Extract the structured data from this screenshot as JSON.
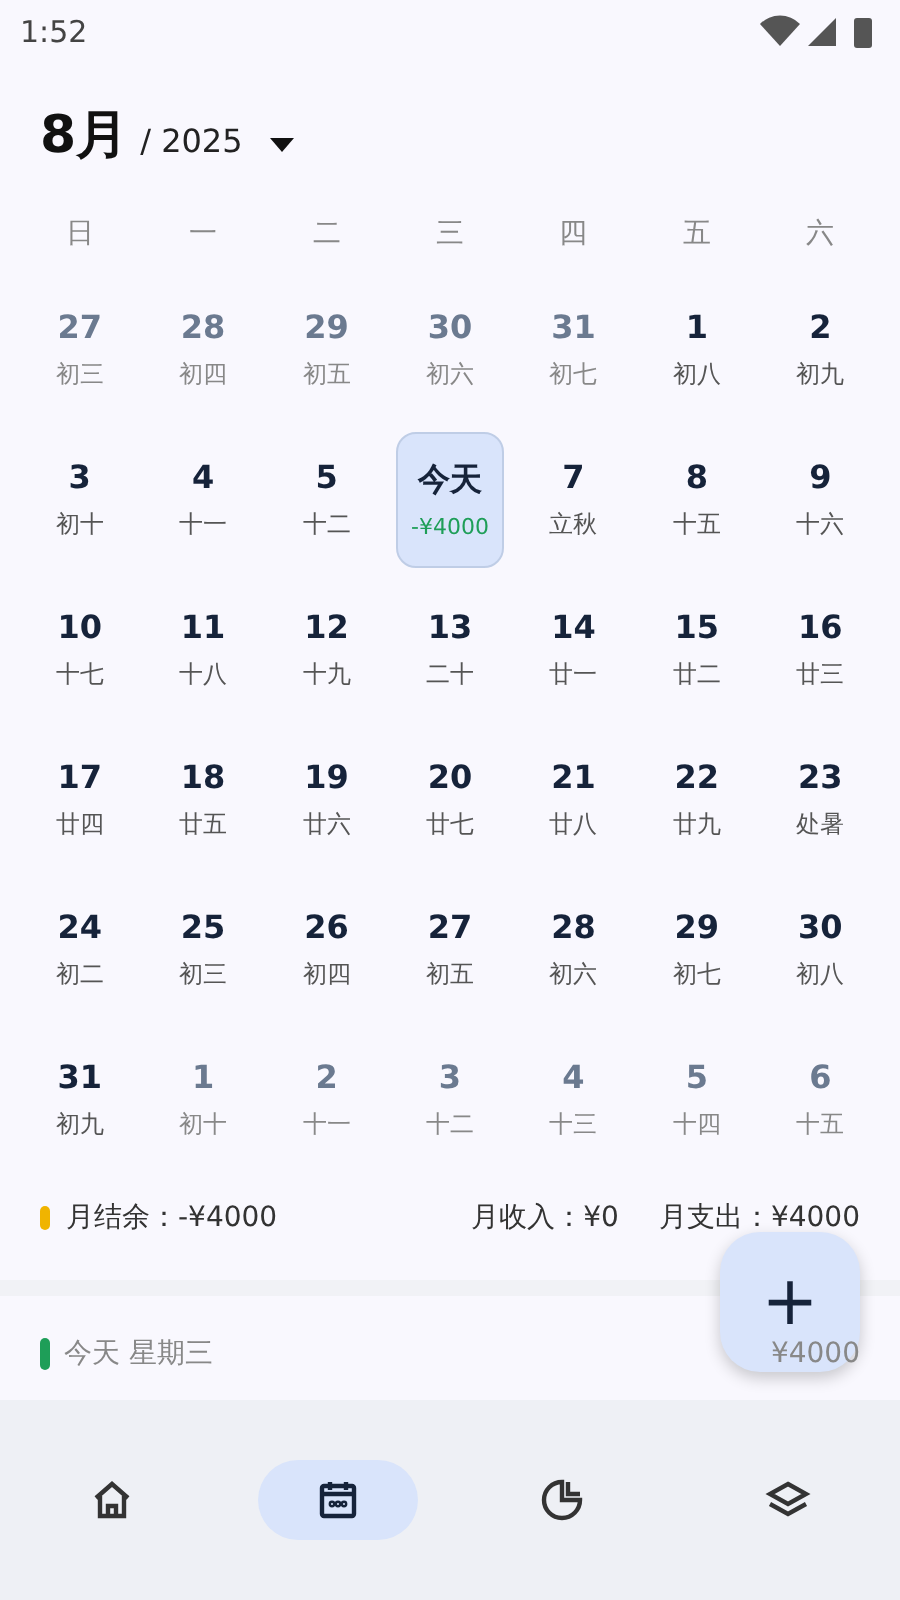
{
  "status_bar": {
    "time": "1:52"
  },
  "header": {
    "month": "8月",
    "year": "/ 2025"
  },
  "weekdays": [
    "日",
    "一",
    "二",
    "三",
    "四",
    "五",
    "六"
  ],
  "days": [
    {
      "day": "27",
      "sub": "初三",
      "muted": true,
      "selected": false
    },
    {
      "day": "28",
      "sub": "初四",
      "muted": true,
      "selected": false
    },
    {
      "day": "29",
      "sub": "初五",
      "muted": true,
      "selected": false
    },
    {
      "day": "30",
      "sub": "初六",
      "muted": true,
      "selected": false
    },
    {
      "day": "31",
      "sub": "初七",
      "muted": true,
      "selected": false
    },
    {
      "day": "1",
      "sub": "初八",
      "muted": false,
      "selected": false
    },
    {
      "day": "2",
      "sub": "初九",
      "muted": false,
      "selected": false
    },
    {
      "day": "3",
      "sub": "初十",
      "muted": false,
      "selected": false
    },
    {
      "day": "4",
      "sub": "十一",
      "muted": false,
      "selected": false
    },
    {
      "day": "5",
      "sub": "十二",
      "muted": false,
      "selected": false
    },
    {
      "day": "今天",
      "sub": "-¥4000",
      "muted": false,
      "selected": true
    },
    {
      "day": "7",
      "sub": "立秋",
      "muted": false,
      "selected": false
    },
    {
      "day": "8",
      "sub": "十五",
      "muted": false,
      "selected": false
    },
    {
      "day": "9",
      "sub": "十六",
      "muted": false,
      "selected": false
    },
    {
      "day": "10",
      "sub": "十七",
      "muted": false,
      "selected": false
    },
    {
      "day": "11",
      "sub": "十八",
      "muted": false,
      "selected": false
    },
    {
      "day": "12",
      "sub": "十九",
      "muted": false,
      "selected": false
    },
    {
      "day": "13",
      "sub": "二十",
      "muted": false,
      "selected": false
    },
    {
      "day": "14",
      "sub": "廿一",
      "muted": false,
      "selected": false
    },
    {
      "day": "15",
      "sub": "廿二",
      "muted": false,
      "selected": false
    },
    {
      "day": "16",
      "sub": "廿三",
      "muted": false,
      "selected": false
    },
    {
      "day": "17",
      "sub": "廿四",
      "muted": false,
      "selected": false
    },
    {
      "day": "18",
      "sub": "廿五",
      "muted": false,
      "selected": false
    },
    {
      "day": "19",
      "sub": "廿六",
      "muted": false,
      "selected": false
    },
    {
      "day": "20",
      "sub": "廿七",
      "muted": false,
      "selected": false
    },
    {
      "day": "21",
      "sub": "廿八",
      "muted": false,
      "selected": false
    },
    {
      "day": "22",
      "sub": "廿九",
      "muted": false,
      "selected": false
    },
    {
      "day": "23",
      "sub": "处暑",
      "muted": false,
      "selected": false
    },
    {
      "day": "24",
      "sub": "初二",
      "muted": false,
      "selected": false
    },
    {
      "day": "25",
      "sub": "初三",
      "muted": false,
      "selected": false
    },
    {
      "day": "26",
      "sub": "初四",
      "muted": false,
      "selected": false
    },
    {
      "day": "27",
      "sub": "初五",
      "muted": false,
      "selected": false
    },
    {
      "day": "28",
      "sub": "初六",
      "muted": false,
      "selected": false
    },
    {
      "day": "29",
      "sub": "初七",
      "muted": false,
      "selected": false
    },
    {
      "day": "30",
      "sub": "初八",
      "muted": false,
      "selected": false
    },
    {
      "day": "31",
      "sub": "初九",
      "muted": false,
      "selected": false
    },
    {
      "day": "1",
      "sub": "初十",
      "muted": true,
      "selected": false
    },
    {
      "day": "2",
      "sub": "十一",
      "muted": true,
      "selected": false
    },
    {
      "day": "3",
      "sub": "十二",
      "muted": true,
      "selected": false
    },
    {
      "day": "4",
      "sub": "十三",
      "muted": true,
      "selected": false
    },
    {
      "day": "5",
      "sub": "十四",
      "muted": true,
      "selected": false
    },
    {
      "day": "6",
      "sub": "十五",
      "muted": true,
      "selected": false
    }
  ],
  "summary": {
    "balance": "月结余：-¥4000",
    "color": "#f0b400",
    "income": "月收入：¥0",
    "expense": "月支出：¥4000"
  },
  "today_row": {
    "label": "今天 星期三",
    "color": "#1e9e58",
    "amount": "¥4000"
  },
  "fab": {
    "label": "+"
  },
  "nav": [
    {
      "kind": "home",
      "selected": false
    },
    {
      "kind": "calendar",
      "selected": true
    },
    {
      "kind": "chart",
      "selected": false
    },
    {
      "kind": "layers",
      "selected": false
    }
  ]
}
